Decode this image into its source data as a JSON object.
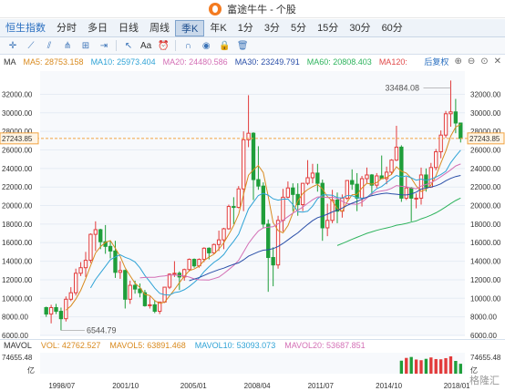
{
  "window": {
    "title": "富途牛牛 - 个股"
  },
  "period_tabs": [
    {
      "label": "恒生指数",
      "highlight": true
    },
    {
      "label": "分时"
    },
    {
      "label": "多日"
    },
    {
      "label": "日线"
    },
    {
      "label": "周线"
    },
    {
      "label": "季K",
      "active": true
    },
    {
      "label": "年K"
    },
    {
      "label": "1分"
    },
    {
      "label": "3分"
    },
    {
      "label": "5分"
    },
    {
      "label": "15分"
    },
    {
      "label": "30分"
    },
    {
      "label": "60分"
    }
  ],
  "toolbar": {
    "tools": [
      {
        "icon": "crosshair-icon",
        "glyph": "✛"
      },
      {
        "icon": "line-draw-icon",
        "glyph": "⟋"
      },
      {
        "icon": "channel-icon",
        "glyph": "⫽"
      },
      {
        "icon": "fork-icon",
        "glyph": "⋔"
      },
      {
        "icon": "grid-tool-icon",
        "glyph": "⊞"
      },
      {
        "icon": "range-icon",
        "glyph": "⇥"
      },
      {
        "icon": "arrow-icon",
        "glyph": "↖"
      },
      {
        "icon": "text-tool-icon",
        "glyph": "Aa"
      },
      {
        "icon": "alarm-icon",
        "glyph": "⏰"
      },
      {
        "icon": "magnet-icon",
        "glyph": "∩"
      },
      {
        "icon": "eye-icon",
        "glyph": "◉"
      },
      {
        "icon": "lock-icon",
        "glyph": "🔒"
      },
      {
        "icon": "delete-icon",
        "glyph": "🗑"
      }
    ]
  },
  "ma_legend": {
    "label": "MA",
    "items": [
      {
        "label": "MA5: 28753.158",
        "color": "#d98a1e"
      },
      {
        "label": "MA10: 25973.404",
        "color": "#2fa3d6"
      },
      {
        "label": "MA20: 24480.586",
        "color": "#d36fb5"
      },
      {
        "label": "MA30: 23249.791",
        "color": "#2a4fa8"
      },
      {
        "label": "MA60: 20808.403",
        "color": "#2db35c"
      },
      {
        "label": "MA120:",
        "color": "#e04848"
      }
    ],
    "adjust_label": "后复权"
  },
  "chart_data": {
    "type": "candlestick",
    "title": "",
    "y_ticks": [
      "32000.00",
      "30000.00",
      "28000.00",
      "26000.00",
      "24000.00",
      "22000.00",
      "20000.00",
      "18000.00",
      "16000.00",
      "14000.00",
      "12000.00",
      "10000.00",
      "8000.00",
      "6000.00"
    ],
    "ylim": [
      6000,
      34500
    ],
    "x_labels": [
      "1998/07",
      "2001/10",
      "2005/01",
      "2008/04",
      "2011/07",
      "2014/10",
      "2018/01"
    ],
    "current_price": "27243.85",
    "annotations": {
      "high": "33484.08",
      "low": "6544.79"
    },
    "candles": [
      {
        "t": "1997Q3",
        "o": 9000,
        "h": 9100,
        "l": 8000,
        "c": 8300
      },
      {
        "t": "1997Q4",
        "o": 8300,
        "h": 9300,
        "l": 7300,
        "c": 9000
      },
      {
        "t": "1998Q1",
        "o": 9000,
        "h": 9400,
        "l": 8300,
        "c": 8600
      },
      {
        "t": "1998Q2",
        "o": 8600,
        "h": 9000,
        "l": 6545,
        "c": 7800
      },
      {
        "t": "1998Q3",
        "o": 7800,
        "h": 10200,
        "l": 7500,
        "c": 9900
      },
      {
        "t": "1998Q4",
        "o": 9900,
        "h": 11200,
        "l": 9700,
        "c": 10600
      },
      {
        "t": "1999Q1",
        "o": 10600,
        "h": 13200,
        "l": 10300,
        "c": 12700
      },
      {
        "t": "1999Q2",
        "o": 12700,
        "h": 13900,
        "l": 12400,
        "c": 13300
      },
      {
        "t": "1999Q3",
        "o": 13300,
        "h": 15000,
        "l": 12300,
        "c": 14100
      },
      {
        "t": "1999Q4",
        "o": 14100,
        "h": 17000,
        "l": 13800,
        "c": 16900
      },
      {
        "t": "2000Q1",
        "o": 16900,
        "h": 18300,
        "l": 15100,
        "c": 17400
      },
      {
        "t": "2000Q2",
        "o": 17400,
        "h": 17500,
        "l": 15300,
        "c": 16100
      },
      {
        "t": "2000Q3",
        "o": 16100,
        "h": 17900,
        "l": 14800,
        "c": 15600
      },
      {
        "t": "2000Q4",
        "o": 15600,
        "h": 16200,
        "l": 14300,
        "c": 15100
      },
      {
        "t": "2001Q1",
        "o": 15100,
        "h": 16200,
        "l": 12200,
        "c": 12800
      },
      {
        "t": "2001Q2",
        "o": 12800,
        "h": 14000,
        "l": 12100,
        "c": 13000
      },
      {
        "t": "2001Q3",
        "o": 13000,
        "h": 13100,
        "l": 8900,
        "c": 9900
      },
      {
        "t": "2001Q4",
        "o": 9900,
        "h": 11900,
        "l": 9400,
        "c": 11400
      },
      {
        "t": "2002Q1",
        "o": 11400,
        "h": 11900,
        "l": 10500,
        "c": 11000
      },
      {
        "t": "2002Q2",
        "o": 11000,
        "h": 11600,
        "l": 10100,
        "c": 10600
      },
      {
        "t": "2002Q3",
        "o": 10600,
        "h": 10900,
        "l": 9100,
        "c": 9200
      },
      {
        "t": "2002Q4",
        "o": 9200,
        "h": 10200,
        "l": 8900,
        "c": 9300
      },
      {
        "t": "2003Q1",
        "o": 9300,
        "h": 9800,
        "l": 8400,
        "c": 8600
      },
      {
        "t": "2003Q2",
        "o": 8600,
        "h": 9600,
        "l": 8300,
        "c": 9600
      },
      {
        "t": "2003Q3",
        "o": 9600,
        "h": 11200,
        "l": 9500,
        "c": 11200
      },
      {
        "t": "2003Q4",
        "o": 11200,
        "h": 12700,
        "l": 11000,
        "c": 12600
      },
      {
        "t": "2004Q1",
        "o": 12600,
        "h": 14000,
        "l": 12300,
        "c": 12700
      },
      {
        "t": "2004Q2",
        "o": 12700,
        "h": 12900,
        "l": 10900,
        "c": 12300
      },
      {
        "t": "2004Q3",
        "o": 12300,
        "h": 13200,
        "l": 11900,
        "c": 13100
      },
      {
        "t": "2004Q4",
        "o": 13100,
        "h": 14300,
        "l": 12900,
        "c": 14200
      },
      {
        "t": "2005Q1",
        "o": 14200,
        "h": 14300,
        "l": 13300,
        "c": 13500
      },
      {
        "t": "2005Q2",
        "o": 13500,
        "h": 14300,
        "l": 13300,
        "c": 14200
      },
      {
        "t": "2005Q3",
        "o": 14200,
        "h": 15500,
        "l": 13900,
        "c": 15400
      },
      {
        "t": "2005Q4",
        "o": 15400,
        "h": 15500,
        "l": 14200,
        "c": 14900
      },
      {
        "t": "2006Q1",
        "o": 14900,
        "h": 15900,
        "l": 14800,
        "c": 15800
      },
      {
        "t": "2006Q2",
        "o": 15800,
        "h": 17300,
        "l": 15100,
        "c": 16300
      },
      {
        "t": "2006Q3",
        "o": 16300,
        "h": 17600,
        "l": 15300,
        "c": 17500
      },
      {
        "t": "2006Q4",
        "o": 17500,
        "h": 20100,
        "l": 17400,
        "c": 19900
      },
      {
        "t": "2007Q1",
        "o": 19900,
        "h": 20900,
        "l": 18000,
        "c": 19800
      },
      {
        "t": "2007Q2",
        "o": 19800,
        "h": 22100,
        "l": 19700,
        "c": 21800
      },
      {
        "t": "2007Q3",
        "o": 21800,
        "h": 28000,
        "l": 19400,
        "c": 27100
      },
      {
        "t": "2007Q4",
        "o": 27100,
        "h": 31900,
        "l": 26300,
        "c": 27800
      },
      {
        "t": "2008Q1",
        "o": 27800,
        "h": 27900,
        "l": 20600,
        "c": 22800
      },
      {
        "t": "2008Q2",
        "o": 22800,
        "h": 26400,
        "l": 21700,
        "c": 22100
      },
      {
        "t": "2008Q3",
        "o": 22100,
        "h": 22500,
        "l": 17600,
        "c": 18000
      },
      {
        "t": "2008Q4",
        "o": 18000,
        "h": 18500,
        "l": 10700,
        "c": 14400
      },
      {
        "t": "2009Q1",
        "o": 14400,
        "h": 15500,
        "l": 11300,
        "c": 13600
      },
      {
        "t": "2009Q2",
        "o": 13600,
        "h": 18900,
        "l": 13200,
        "c": 18400
      },
      {
        "t": "2009Q3",
        "o": 18400,
        "h": 21800,
        "l": 17200,
        "c": 20900
      },
      {
        "t": "2009Q4",
        "o": 20900,
        "h": 22600,
        "l": 20800,
        "c": 21900
      },
      {
        "t": "2010Q1",
        "o": 21900,
        "h": 22400,
        "l": 19400,
        "c": 21200
      },
      {
        "t": "2010Q2",
        "o": 21200,
        "h": 22400,
        "l": 18900,
        "c": 20100
      },
      {
        "t": "2010Q3",
        "o": 20100,
        "h": 22300,
        "l": 19400,
        "c": 22400
      },
      {
        "t": "2010Q4",
        "o": 22400,
        "h": 24900,
        "l": 22200,
        "c": 23000
      },
      {
        "t": "2011Q1",
        "o": 23000,
        "h": 24500,
        "l": 22400,
        "c": 23500
      },
      {
        "t": "2011Q2",
        "o": 23500,
        "h": 24500,
        "l": 21500,
        "c": 22400
      },
      {
        "t": "2011Q3",
        "o": 22400,
        "h": 22800,
        "l": 16200,
        "c": 17600
      },
      {
        "t": "2011Q4",
        "o": 17600,
        "h": 20200,
        "l": 16700,
        "c": 18400
      },
      {
        "t": "2012Q1",
        "o": 18400,
        "h": 21700,
        "l": 18100,
        "c": 20600
      },
      {
        "t": "2012Q2",
        "o": 20600,
        "h": 21400,
        "l": 18100,
        "c": 19400
      },
      {
        "t": "2012Q3",
        "o": 19400,
        "h": 21200,
        "l": 18700,
        "c": 20800
      },
      {
        "t": "2012Q4",
        "o": 20800,
        "h": 22700,
        "l": 20600,
        "c": 22700
      },
      {
        "t": "2013Q1",
        "o": 22700,
        "h": 23900,
        "l": 21700,
        "c": 22300
      },
      {
        "t": "2013Q2",
        "o": 22300,
        "h": 23500,
        "l": 19400,
        "c": 20800
      },
      {
        "t": "2013Q3",
        "o": 20800,
        "h": 23200,
        "l": 19900,
        "c": 22900
      },
      {
        "t": "2013Q4",
        "o": 22900,
        "h": 24100,
        "l": 22400,
        "c": 23300
      },
      {
        "t": "2014Q1",
        "o": 23300,
        "h": 23400,
        "l": 21100,
        "c": 22200
      },
      {
        "t": "2014Q2",
        "o": 22200,
        "h": 23500,
        "l": 21900,
        "c": 23200
      },
      {
        "t": "2014Q3",
        "o": 23200,
        "h": 25400,
        "l": 22900,
        "c": 22900
      },
      {
        "t": "2014Q4",
        "o": 22900,
        "h": 24200,
        "l": 22300,
        "c": 23600
      },
      {
        "t": "2015Q1",
        "o": 23600,
        "h": 25000,
        "l": 23300,
        "c": 24900
      },
      {
        "t": "2015Q2",
        "o": 24900,
        "h": 28600,
        "l": 24800,
        "c": 26300
      },
      {
        "t": "2015Q3",
        "o": 26300,
        "h": 26500,
        "l": 20400,
        "c": 20800
      },
      {
        "t": "2015Q4",
        "o": 20800,
        "h": 23100,
        "l": 20600,
        "c": 21900
      },
      {
        "t": "2016Q1",
        "o": 21900,
        "h": 22000,
        "l": 18300,
        "c": 20800
      },
      {
        "t": "2016Q2",
        "o": 20800,
        "h": 21300,
        "l": 19700,
        "c": 20800
      },
      {
        "t": "2016Q3",
        "o": 20800,
        "h": 24100,
        "l": 20100,
        "c": 23300
      },
      {
        "t": "2016Q4",
        "o": 23300,
        "h": 24000,
        "l": 21500,
        "c": 22000
      },
      {
        "t": "2017Q1",
        "o": 22000,
        "h": 24600,
        "l": 21900,
        "c": 24100
      },
      {
        "t": "2017Q2",
        "o": 24100,
        "h": 26100,
        "l": 23800,
        "c": 25800
      },
      {
        "t": "2017Q3",
        "o": 25800,
        "h": 28100,
        "l": 25100,
        "c": 27600
      },
      {
        "t": "2017Q4",
        "o": 27600,
        "h": 30200,
        "l": 27300,
        "c": 29900
      },
      {
        "t": "2018Q1",
        "o": 29900,
        "h": 33484,
        "l": 28500,
        "c": 30100
      },
      {
        "t": "2018Q2",
        "o": 30100,
        "h": 31500,
        "l": 27800,
        "c": 28900
      },
      {
        "t": "2018Q3",
        "o": 28900,
        "h": 28900,
        "l": 26800,
        "c": 27244
      }
    ],
    "volume": {
      "label": "MAVOL",
      "top_tick": "74655.48",
      "unit": "亿",
      "items": [
        {
          "label": "VOL: 42762.527",
          "color": "#d98a1e"
        },
        {
          "label": "MAVOL5: 63891.468",
          "color": "#d98a1e"
        },
        {
          "label": "MAVOL10: 53093.073",
          "color": "#2fa3d6"
        },
        {
          "label": "MAVOL20: 53687.851",
          "color": "#d36fb5"
        }
      ],
      "values": [
        56000,
        68000,
        72000,
        61000,
        58000,
        64000,
        70000,
        63000,
        62000,
        67000,
        74655,
        55000,
        42762
      ]
    }
  },
  "watermark": "格隆汇",
  "colors": {
    "up": "#e23b3b",
    "down": "#1f9e3a",
    "price_line": "#f2a341",
    "grid": "#e6ecf4",
    "axis_text": "#333333"
  }
}
